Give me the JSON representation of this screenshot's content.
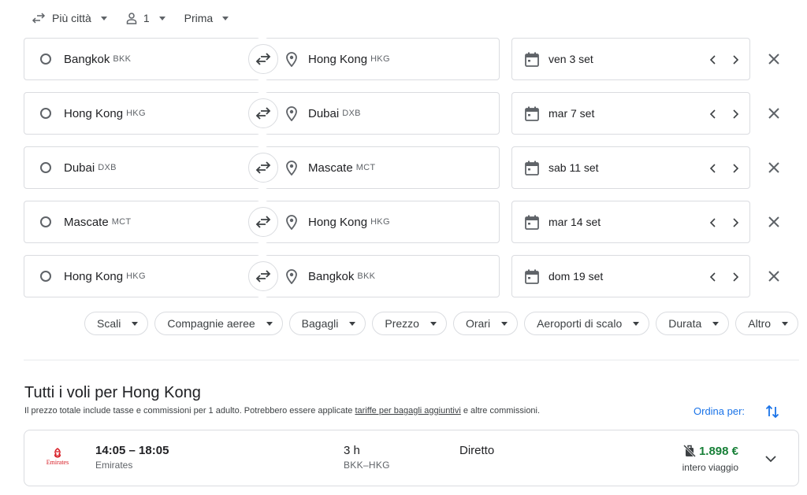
{
  "top_options": {
    "trip_type": "Più città",
    "passengers": "1",
    "cabin_class": "Prima"
  },
  "legs": [
    {
      "origin_city": "Bangkok",
      "origin_code": "BKK",
      "dest_city": "Hong Kong",
      "dest_code": "HKG",
      "date": "ven 3 set"
    },
    {
      "origin_city": "Hong Kong",
      "origin_code": "HKG",
      "dest_city": "Dubai",
      "dest_code": "DXB",
      "date": "mar 7 set"
    },
    {
      "origin_city": "Dubai",
      "origin_code": "DXB",
      "dest_city": "Mascate",
      "dest_code": "MCT",
      "date": "sab 11 set"
    },
    {
      "origin_city": "Mascate",
      "origin_code": "MCT",
      "dest_city": "Hong Kong",
      "dest_code": "HKG",
      "date": "mar 14 set"
    },
    {
      "origin_city": "Hong Kong",
      "origin_code": "HKG",
      "dest_city": "Bangkok",
      "dest_code": "BKK",
      "date": "dom 19 set"
    }
  ],
  "filters": [
    "Scali",
    "Compagnie aeree",
    "Bagagli",
    "Prezzo",
    "Orari",
    "Aeroporti di scalo",
    "Durata",
    "Altro"
  ],
  "results": {
    "title": "Tutti i voli per Hong Kong",
    "subtitle_before": "Il prezzo totale include tasse e commissioni per 1 adulto. Potrebbero essere applicate ",
    "subtitle_link": "tariffe per bagagli aggiuntivi",
    "subtitle_after": " e altre commissioni.",
    "sort_label": "Ordina per:"
  },
  "flight": {
    "logo_text": "Emirates",
    "times": "14:05 – 18:05",
    "airline": "Emirates",
    "duration": "3 h",
    "route": "BKK–HKG",
    "stops": "Diretto",
    "price": "1.898 €",
    "price_note": "intero viaggio"
  },
  "colors": {
    "accent": "#1a73e8",
    "price": "#188038",
    "border": "#dadce0",
    "emirates_red": "#d71921"
  },
  "icons": {
    "trip_type": "swap-arrows-icon",
    "passengers": "person-icon",
    "origin": "ring-icon",
    "destination": "pin-icon",
    "swap": "swap-icon",
    "date": "calendar-icon",
    "prev": "chevron-left-icon",
    "next": "chevron-right-icon",
    "remove": "close-icon",
    "sort": "sort-icon",
    "price": "no-bag-icon",
    "expand": "chevron-down-icon"
  }
}
